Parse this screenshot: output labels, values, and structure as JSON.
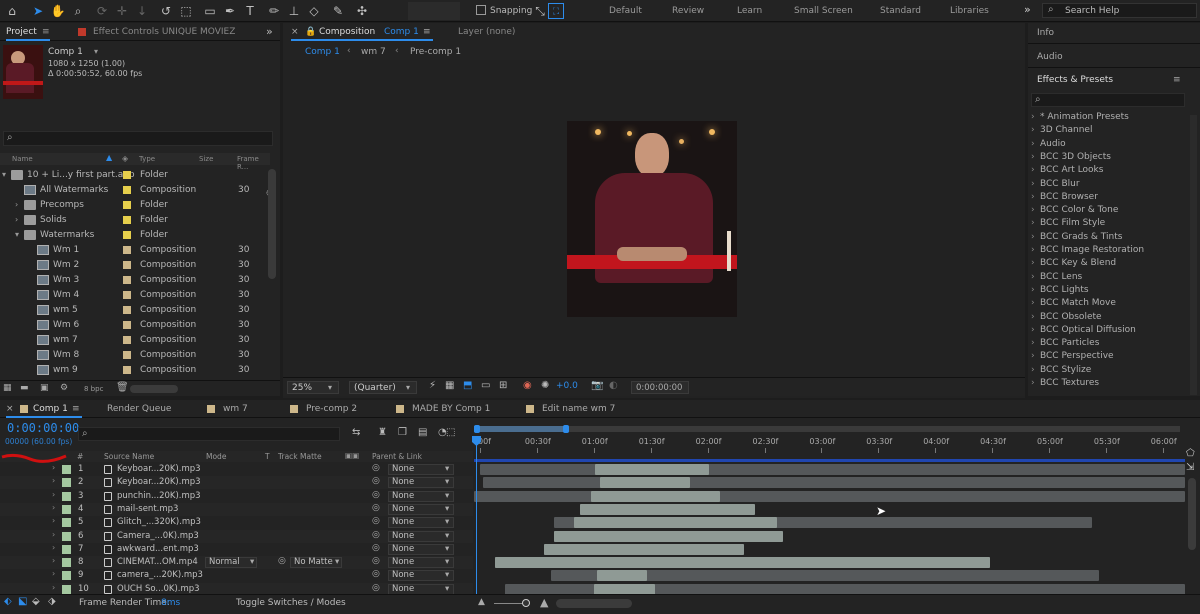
{
  "toolbar": {
    "snapping_label": "Snapping",
    "workspaces": [
      "Default",
      "Review",
      "Learn",
      "Small Screen",
      "Standard",
      "Libraries"
    ],
    "search_help": "Search Help"
  },
  "project_panel": {
    "tab_project": "Project",
    "tab_effect_controls": "Effect Controls UNIQUE MOVIEZ",
    "comp_name": "Comp 1",
    "comp_dims": "1080 x 1250 (1.00)",
    "comp_duration": "Δ 0:00:50:52, 60.00 fps",
    "columns": {
      "name": "Name",
      "type": "Type",
      "size": "Size",
      "frame_rate": "Frame R..."
    },
    "items": [
      {
        "name": "10 + Li...y first part.aep",
        "type": "Folder",
        "fps": "",
        "indent": 0,
        "kind": "folder",
        "label": "#e6cf4c"
      },
      {
        "name": "All Watermarks",
        "type": "Composition",
        "fps": "30",
        "indent": 1,
        "kind": "comp",
        "label": "#e6cf4c"
      },
      {
        "name": "Precomps",
        "type": "Folder",
        "fps": "",
        "indent": 1,
        "kind": "folder",
        "label": "#e6cf4c"
      },
      {
        "name": "Solids",
        "type": "Folder",
        "fps": "",
        "indent": 1,
        "kind": "folder",
        "label": "#e6cf4c"
      },
      {
        "name": "Watermarks",
        "type": "Folder",
        "fps": "",
        "indent": 1,
        "kind": "folder",
        "label": "#e6cf4c"
      },
      {
        "name": "Wm 1",
        "type": "Composition",
        "fps": "30",
        "indent": 2,
        "kind": "comp",
        "label": "#cdb78a"
      },
      {
        "name": "Wm 2",
        "type": "Composition",
        "fps": "30",
        "indent": 2,
        "kind": "comp",
        "label": "#cdb78a"
      },
      {
        "name": "Wm 3",
        "type": "Composition",
        "fps": "30",
        "indent": 2,
        "kind": "comp",
        "label": "#cdb78a"
      },
      {
        "name": "Wm 4",
        "type": "Composition",
        "fps": "30",
        "indent": 2,
        "kind": "comp",
        "label": "#cdb78a"
      },
      {
        "name": "wm 5",
        "type": "Composition",
        "fps": "30",
        "indent": 2,
        "kind": "comp",
        "label": "#cdb78a"
      },
      {
        "name": "Wm 6",
        "type": "Composition",
        "fps": "30",
        "indent": 2,
        "kind": "comp",
        "label": "#cdb78a"
      },
      {
        "name": "wm 7",
        "type": "Composition",
        "fps": "30",
        "indent": 2,
        "kind": "comp",
        "label": "#cdb78a"
      },
      {
        "name": "Wm 8",
        "type": "Composition",
        "fps": "30",
        "indent": 2,
        "kind": "comp",
        "label": "#cdb78a"
      },
      {
        "name": "wm 9",
        "type": "Composition",
        "fps": "30",
        "indent": 2,
        "kind": "comp",
        "label": "#cdb78a"
      }
    ],
    "bpc": "8 bpc"
  },
  "viewer": {
    "tab_label": "Composition",
    "tab_comp": "Comp 1",
    "layer_label": "Layer (none)",
    "breadcrumbs": [
      "Comp 1",
      "wm 7",
      "Pre-comp 1"
    ],
    "zoom": "25%",
    "resolution": "(Quarter)",
    "exposure": "+0.0",
    "timecode": "0:00:00:00"
  },
  "right_panel": {
    "info": "Info",
    "audio": "Audio",
    "effects_title": "Effects & Presets",
    "effects": [
      "* Animation Presets",
      "3D Channel",
      "Audio",
      "BCC 3D Objects",
      "BCC Art Looks",
      "BCC Blur",
      "BCC Browser",
      "BCC Color & Tone",
      "BCC Film Style",
      "BCC Grads & Tints",
      "BCC Image Restoration",
      "BCC Key & Blend",
      "BCC Lens",
      "BCC Lights",
      "BCC Match Move",
      "BCC Obsolete",
      "BCC Optical Diffusion",
      "BCC Particles",
      "BCC Perspective",
      "BCC Stylize",
      "BCC Textures"
    ]
  },
  "timeline": {
    "tabs": [
      "Comp 1",
      "Render Queue",
      "wm 7",
      "Pre-comp 2",
      "MADE BY Comp 1",
      "Edit name wm 7"
    ],
    "timecode": "0:00:00:00",
    "frame_info": "00000 (60.00 fps)",
    "col_source": "Source Name",
    "col_mode": "Mode",
    "col_t": "T",
    "col_track": "Track Matte",
    "col_parent": "Parent & Link",
    "ruler": [
      "00f",
      "00:30f",
      "01:00f",
      "01:30f",
      "02:00f",
      "02:30f",
      "03:00f",
      "03:30f",
      "04:00f",
      "04:30f",
      "05:00f",
      "05:30f",
      "06:00f"
    ],
    "layers": [
      {
        "num": "1",
        "name": "Keyboar...20K).mp3",
        "parent": "None",
        "mode": "",
        "track": "",
        "bar": [
          595,
          709
        ],
        "bg": [
          480,
          1185
        ]
      },
      {
        "num": "2",
        "name": "Keyboar...20K).mp3",
        "parent": "None",
        "mode": "",
        "track": "",
        "bar": [
          600,
          690
        ],
        "bg": [
          483,
          1185
        ]
      },
      {
        "num": "3",
        "name": "punchin...20K).mp3",
        "parent": "None",
        "mode": "",
        "track": "",
        "bar": [
          591,
          720
        ],
        "bg": [
          474,
          1185
        ]
      },
      {
        "num": "4",
        "name": "mail-sent.mp3",
        "parent": "None",
        "mode": "",
        "track": "",
        "bar": [
          580,
          755
        ],
        "bg": [
          580,
          755
        ]
      },
      {
        "num": "5",
        "name": "Glitch_...320K).mp3",
        "parent": "None",
        "mode": "",
        "track": "",
        "bar": [
          574,
          777
        ],
        "bg": [
          554,
          1092
        ]
      },
      {
        "num": "6",
        "name": "Camera_...0K).mp3",
        "parent": "None",
        "mode": "",
        "track": "",
        "bar": [
          554,
          783
        ],
        "bg": [
          554,
          783
        ]
      },
      {
        "num": "7",
        "name": "awkward...ent.mp3",
        "parent": "None",
        "mode": "",
        "track": "",
        "bar": [
          544,
          744
        ],
        "bg": [
          544,
          744
        ]
      },
      {
        "num": "8",
        "name": "CINEMAT...OM.mp4",
        "parent": "None",
        "mode": "Normal",
        "track": "No Matte",
        "bar": [
          495,
          990
        ],
        "bg": [
          495,
          990
        ]
      },
      {
        "num": "9",
        "name": "camera_...20K).mp3",
        "parent": "None",
        "mode": "",
        "track": "",
        "bar": [
          597,
          647
        ],
        "bg": [
          551,
          1099
        ]
      },
      {
        "num": "10",
        "name": "OUCH So...0K).mp3",
        "parent": "None",
        "mode": "",
        "track": "",
        "bar": [
          594,
          655
        ],
        "bg": [
          505,
          1185
        ]
      }
    ],
    "frame_render_label": "Frame Render Time:",
    "frame_render_value": "8ms",
    "toggle_label": "Toggle Switches / Modes"
  }
}
